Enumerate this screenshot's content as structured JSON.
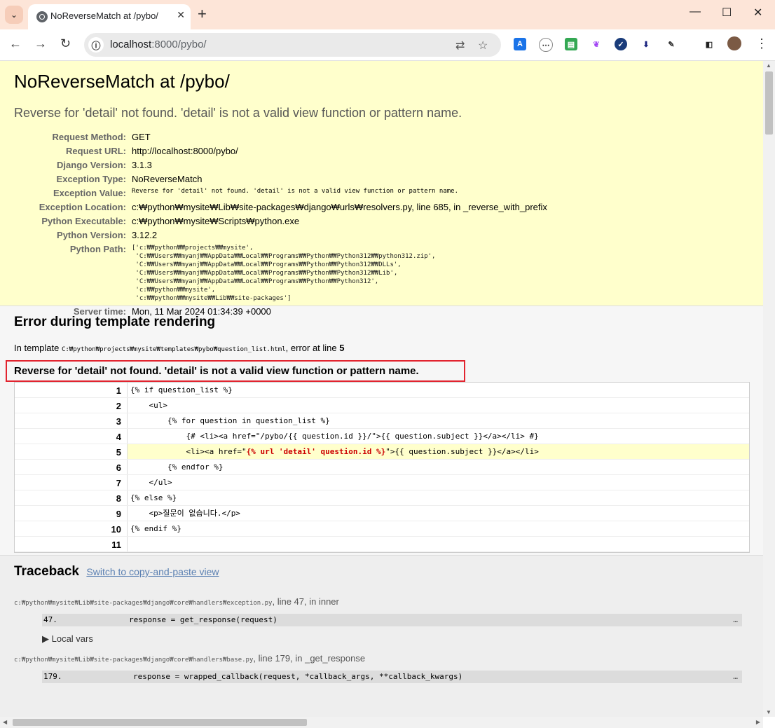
{
  "browser": {
    "tab_title": "NoReverseMatch at /pybo/",
    "url_host": "localhost",
    "url_path": ":8000/pybo/",
    "new_tab": "+",
    "close": "✕"
  },
  "page": {
    "title": "NoReverseMatch at /pybo/",
    "exception_value": "Reverse for 'detail' not found. 'detail' is not a valid view function or pattern name.",
    "meta": [
      {
        "label": "Request Method:",
        "value": "GET"
      },
      {
        "label": "Request URL:",
        "value": "http://localhost:8000/pybo/"
      },
      {
        "label": "Django Version:",
        "value": "3.1.3"
      },
      {
        "label": "Exception Type:",
        "value": "NoReverseMatch"
      },
      {
        "label": "Exception Value:",
        "value": "Reverse for 'detail' not found. 'detail' is not a valid view function or pattern name."
      },
      {
        "label": "Exception Location:",
        "value": "c:₩python₩mysite₩Lib₩site-packages₩django₩urls₩resolvers.py, line 685, in _reverse_with_prefix"
      },
      {
        "label": "Python Executable:",
        "value": "c:₩python₩mysite₩Scripts₩python.exe"
      },
      {
        "label": "Python Version:",
        "value": "3.12.2"
      },
      {
        "label": "Python Path:",
        "value": "['c:₩₩python₩₩projects₩₩mysite',\n 'C:₩₩Users₩₩myanj₩₩AppData₩₩Local₩₩Programs₩₩Python₩₩Python312₩₩python312.zip',\n 'C:₩₩Users₩₩myanj₩₩AppData₩₩Local₩₩Programs₩₩Python₩₩Python312₩₩DLLs',\n 'C:₩₩Users₩₩myanj₩₩AppData₩₩Local₩₩Programs₩₩Python₩₩Python312₩₩Lib',\n 'C:₩₩Users₩₩myanj₩₩AppData₩₩Local₩₩Programs₩₩Python₩₩Python312',\n 'c:₩₩python₩₩mysite',\n 'c:₩₩python₩₩mysite₩₩Lib₩₩site-packages']"
      },
      {
        "label": "Server time:",
        "value": "Mon, 11 Mar 2024 01:34:39 +0000"
      }
    ]
  },
  "template": {
    "heading": "Error during template rendering",
    "in_template": "In template",
    "path": "C:₩python₩projects₩mysite₩templates₩pybo₩question_list.html",
    "error_at": ", error at line",
    "line": "5",
    "error_message": "Reverse for 'detail' not found. 'detail' is not a valid view function or pattern name.",
    "lines": [
      {
        "n": "1",
        "code": "{% if question_list %}"
      },
      {
        "n": "2",
        "code": "    <ul>"
      },
      {
        "n": "3",
        "code": "        {% for question in question_list %}"
      },
      {
        "n": "4",
        "code": "            {# <li><a href=\"/pybo/{{ question.id }}/\">{{ question.subject }}</a></li> #}"
      },
      {
        "n": "5",
        "code_pre": "            <li><a href=\"",
        "code_hl": "{% url 'detail' question.id %}",
        "code_post": "\">{{ question.subject }}</a></li>"
      },
      {
        "n": "6",
        "code": "        {% endfor %}"
      },
      {
        "n": "7",
        "code": "    </ul>"
      },
      {
        "n": "8",
        "code": "{% else %}"
      },
      {
        "n": "9",
        "code": "    <p>질문이 없습니다.</p>"
      },
      {
        "n": "10",
        "code": "{% endif %}"
      },
      {
        "n": "11",
        "code": ""
      }
    ]
  },
  "traceback": {
    "heading": "Traceback",
    "switch_link": "Switch to copy-and-paste view",
    "frames": [
      {
        "path": "c:₩python₩mysite₩Lib₩site-packages₩django₩core₩handlers₩exception.py",
        "loc": ", line 47, in inner",
        "ln": "47.",
        "code": "response = get_response(request)",
        "dots": "…"
      },
      {
        "path": "c:₩python₩mysite₩Lib₩site-packages₩django₩core₩handlers₩base.py",
        "loc": ", line 179, in _get_response",
        "ln": "179.",
        "code": "response = wrapped_callback(request, *callback_args, **callback_kwargs)",
        "dots": "…"
      }
    ],
    "local_vars": "▶ Local vars"
  }
}
